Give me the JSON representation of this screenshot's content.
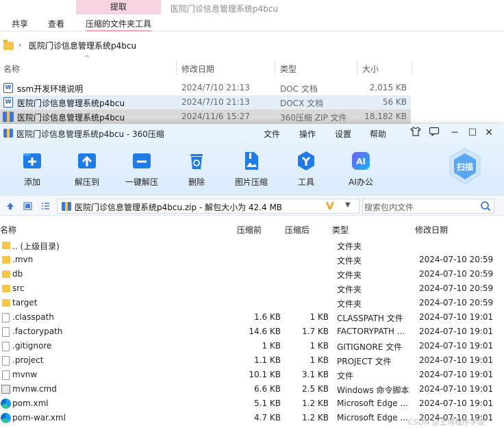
{
  "explorer": {
    "context_tab": "提取",
    "title": "医院门诊信息管理系统p4bcu",
    "tabs": [
      "共享",
      "查看",
      "压缩的文件夹工具"
    ],
    "address": "医院门诊信息管理系统p4bcu",
    "columns": [
      "名称",
      "修改日期",
      "类型",
      "大小"
    ],
    "files": [
      {
        "name": "ssm开发环境说明",
        "date": "2024/7/10 21:13",
        "type": "DOC 文档",
        "size": "2,015 KB"
      },
      {
        "name": "医院门诊信息管理系统p4bcu",
        "date": "2024/7/10 21:13",
        "type": "DOCX 文档",
        "size": "56 KB"
      },
      {
        "name": "医院门诊信息管理系统p4bcu",
        "date": "2024/11/6 15:27",
        "type": "360压缩 ZIP 文件",
        "size": "18,182 KB"
      }
    ]
  },
  "zip": {
    "title": "医院门诊信息管理系统p4bcu - 360压缩",
    "menu": [
      "文件",
      "操作",
      "设置",
      "帮助"
    ],
    "tools": [
      "添加",
      "解压到",
      "一键解压",
      "删除",
      "图片压缩",
      "工具",
      "AI办公"
    ],
    "scan_label": "扫描",
    "path": "医院门诊信息管理系统p4bcu.zip - 解包大小为 42.4 MB",
    "search_placeholder": "搜索包内文件",
    "columns": [
      "名称",
      "压缩前",
      "压缩后",
      "类型",
      "修改日期"
    ],
    "rows": [
      {
        "name": ".. (上级目录)",
        "before": "",
        "after": "",
        "type": "文件夹",
        "date": "",
        "icon": "folder"
      },
      {
        "name": ".mvn",
        "before": "",
        "after": "",
        "type": "文件夹",
        "date": "2024-07-10 20:59",
        "icon": "folder"
      },
      {
        "name": "db",
        "before": "",
        "after": "",
        "type": "文件夹",
        "date": "2024-07-10 20:59",
        "icon": "folder"
      },
      {
        "name": "src",
        "before": "",
        "after": "",
        "type": "文件夹",
        "date": "2024-07-10 20:59",
        "icon": "folder"
      },
      {
        "name": "target",
        "before": "",
        "after": "",
        "type": "文件夹",
        "date": "2024-07-10 20:59",
        "icon": "folder"
      },
      {
        "name": ".classpath",
        "before": "1.6 KB",
        "after": "1 KB",
        "type": "CLASSPATH 文件",
        "date": "2024-07-10 19:01",
        "icon": "file"
      },
      {
        "name": ".factorypath",
        "before": "14.6 KB",
        "after": "1.7 KB",
        "type": "FACTORYPATH ...",
        "date": "2024-07-10 19:01",
        "icon": "file"
      },
      {
        "name": ".gitignore",
        "before": "1 KB",
        "after": "1 KB",
        "type": "GITIGNORE 文件",
        "date": "2024-07-10 19:01",
        "icon": "file"
      },
      {
        "name": ".project",
        "before": "1.1 KB",
        "after": "1 KB",
        "type": "PROJECT 文件",
        "date": "2024-07-10 19:01",
        "icon": "file"
      },
      {
        "name": "mvnw",
        "before": "10.1 KB",
        "after": "3.1 KB",
        "type": "文件",
        "date": "2024-07-10 19:01",
        "icon": "file"
      },
      {
        "name": "mvnw.cmd",
        "before": "6.6 KB",
        "after": "2.5 KB",
        "type": "Windows 命令脚本",
        "date": "2024-07-10 19:01",
        "icon": "cmd"
      },
      {
        "name": "pom.xml",
        "before": "5.1 KB",
        "after": "1.2 KB",
        "type": "Microsoft Edge ...",
        "date": "2024-07-10 19:01",
        "icon": "edge"
      },
      {
        "name": "pom-war.xml",
        "before": "4.7 KB",
        "after": "1.2 KB",
        "type": "Microsoft Edge ...",
        "date": "2024-07-10 19:01",
        "icon": "edge"
      }
    ]
  },
  "watermark": "CSDN @王博程序学设"
}
